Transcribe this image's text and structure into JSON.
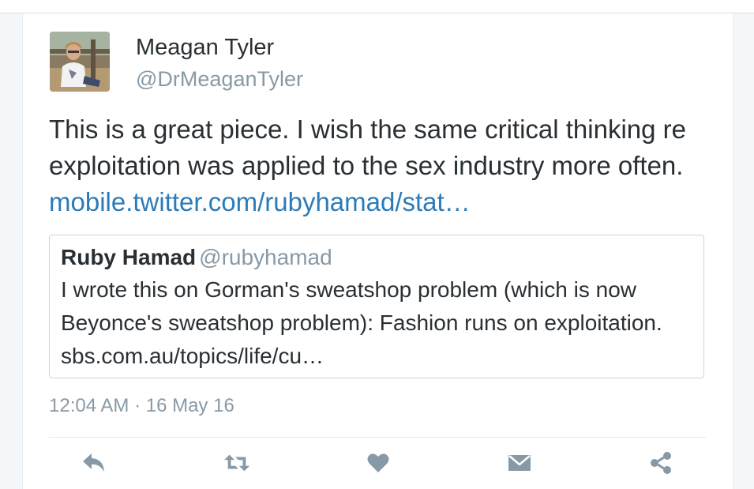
{
  "tweet": {
    "author_name": "Meagan Tyler",
    "author_handle": "@DrMeaganTyler",
    "text": "This is a great piece. I wish the same critical thinking re exploitation was applied to the sex industry more often. ",
    "link_text": "mobile.twitter.com/rubyhamad/stat…",
    "timestamp": "12:04 AM · 16 May 16"
  },
  "quoted_tweet": {
    "author_name": "Ruby Hamad",
    "author_handle": "@rubyhamad",
    "text": "I wrote this on Gorman's sweatshop problem (which is now Beyonce's sweatshop problem): Fashion runs on exploitation. sbs.com.au/topics/life/cu…"
  },
  "actions": [
    {
      "name": "reply",
      "icon": "reply-icon"
    },
    {
      "name": "retweet",
      "icon": "retweet-icon"
    },
    {
      "name": "like",
      "icon": "heart-icon"
    },
    {
      "name": "direct-message",
      "icon": "envelope-icon"
    },
    {
      "name": "share",
      "icon": "share-icon"
    }
  ],
  "colors": {
    "text": "#292f33",
    "secondary_text": "#8899a6",
    "link": "#2b7bb9",
    "icon": "#8899a6"
  }
}
